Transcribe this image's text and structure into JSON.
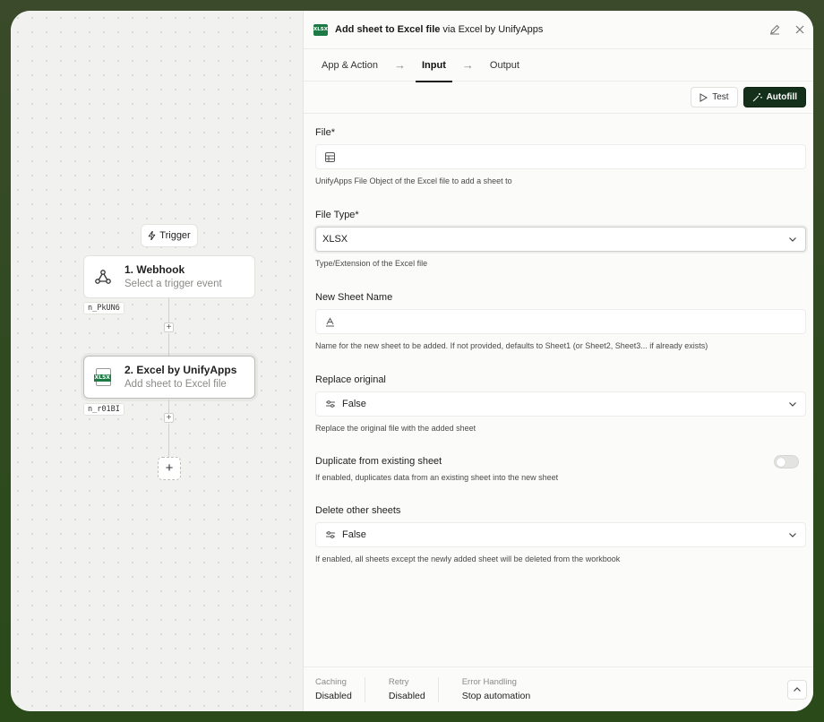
{
  "canvas": {
    "trigger_label": "Trigger",
    "nodes": [
      {
        "title": "1. Webhook",
        "subtitle": "Select a trigger event",
        "id": "n_PkUN6"
      },
      {
        "title": "2. Excel by UnifyApps",
        "subtitle": "Add sheet to Excel file",
        "id": "n_r01BI",
        "icon_text": "XLSX"
      }
    ],
    "plus": "+"
  },
  "header": {
    "badge": "XLSX",
    "title_prefix": "Add sheet to Excel file",
    "title_via": " via ",
    "title_app": "Excel by UnifyApps"
  },
  "tabs": [
    {
      "label": "App & Action"
    },
    {
      "label": "Input",
      "active": true
    },
    {
      "label": "Output"
    }
  ],
  "toolbar": {
    "test_label": "Test",
    "autofill_label": "Autofill"
  },
  "fields": {
    "file": {
      "label": "File*",
      "value": "",
      "help": "UnifyApps File Object of the Excel file to add a sheet to"
    },
    "file_type": {
      "label": "File Type*",
      "value": "XLSX",
      "help": "Type/Extension of the Excel file"
    },
    "new_sheet_name": {
      "label": "New Sheet Name",
      "value": "",
      "help": "Name for the new sheet to be added. If not provided, defaults to Sheet1 (or Sheet2, Sheet3... if already exists)"
    },
    "replace_original": {
      "label": "Replace original",
      "value": "False",
      "help": "Replace the original file with the added sheet"
    },
    "duplicate": {
      "label": "Duplicate from existing sheet",
      "enabled": false,
      "help": "If enabled, duplicates data from an existing sheet into the new sheet"
    },
    "delete_other": {
      "label": "Delete other sheets",
      "value": "False",
      "help": "If enabled, all sheets except the newly added sheet will be deleted from the workbook"
    }
  },
  "footer": {
    "caching_label": "Caching",
    "caching_value": "Disabled",
    "retry_label": "Retry",
    "retry_value": "Disabled",
    "error_label": "Error Handling",
    "error_value": "Stop automation"
  },
  "colors": {
    "accent_dark": "#15301a",
    "excel_green": "#1d7a45"
  }
}
